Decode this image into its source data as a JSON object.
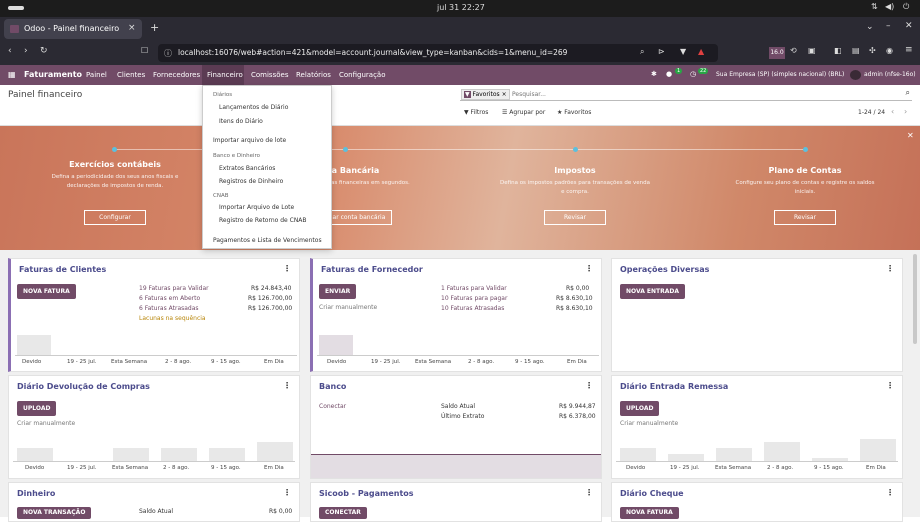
{
  "os": {
    "clock": "jul 31  22:27"
  },
  "browser": {
    "tab_title": "Odoo - Painel financeiro",
    "new_tab": "+",
    "url": "localhost:16076/web#action=421&model=account.journal&view_type=kanban&cids=1&menu_id=269",
    "version_badge": "16.0"
  },
  "nav": {
    "app": "Faturamento",
    "items": [
      "Painel",
      "Clientes",
      "Fornecedores",
      "Financeiro",
      "Comissões",
      "Relatórios",
      "Configuração"
    ],
    "msg_count": "1",
    "activity_count": "22",
    "company": "Sua Empresa (SP) (simples nacional) (BRL)",
    "user": "admin (nfse-16o)"
  },
  "control": {
    "title": "Painel financeiro",
    "facet": "Favoritos",
    "search_placeholder": "Pesquisar...",
    "filters": "Filtros",
    "group": "Agrupar por",
    "favorites": "Favoritos",
    "pager": "1-24 / 24"
  },
  "menu": {
    "s1": "Diários",
    "i1": "Lançamentos de Diário",
    "i2": "Itens do Diário",
    "i3": "Importar arquivo de lote",
    "s2": "Banco e Dinheiro",
    "i4": "Extratos Bancários",
    "i5": "Registros de Dinheiro",
    "s3": "CNAB",
    "i6": "Importar Arquivo de Lote",
    "i7": "Registro de Retorno de CNAB",
    "i8": "Pagamentos e Lista de Vencimentos"
  },
  "onboarding": {
    "s1": {
      "title": "Exercícios contábeis",
      "desc": "Defina a periodicidade dos seus anos fiscais e declarações de impostos de renda.",
      "btn": "Configurar"
    },
    "s2": {
      "title": "Conta Bancária",
      "desc": "Conecte suas contas financeiras em segundos.",
      "btn": "Adicionar conta bancária"
    },
    "s3": {
      "title": "Impostos",
      "desc": "Defina os impostos padrões para transações de venda e compra.",
      "btn": "Revisar"
    },
    "s4": {
      "title": "Plano de Contas",
      "desc": "Configure seu plano de contas e registre os saldos iniciais.",
      "btn": "Revisar"
    }
  },
  "cards": {
    "c1": {
      "title": "Faturas de Clientes",
      "btn": "NOVA FATURA",
      "l1": "19 Faturas para Validar",
      "v1": "R$ 24.843,40",
      "l2": "6 Faturas em Aberto",
      "v2": "R$ 126.700,00",
      "l3": "6 Faturas Atrasadas",
      "v3": "R$ 126.700,00",
      "l4": "Lacunas na sequência"
    },
    "c2": {
      "title": "Faturas de Fornecedor",
      "btn": "ENVIAR",
      "manual": "Criar manualmente",
      "l1": "1 Faturas para Validar",
      "v1": "R$ 0,00",
      "l2": "10 Faturas para pagar",
      "v2": "R$ 8.630,10",
      "l3": "10 Faturas Atrasadas",
      "v3": "R$ 8.630,10"
    },
    "c3": {
      "title": "Operações Diversas",
      "btn": "NOVA ENTRADA"
    },
    "c4": {
      "title": "Diário Devolução de Compras",
      "btn": "UPLOAD",
      "manual": "Criar manualmente"
    },
    "c5": {
      "title": "Banco",
      "connect": "Conectar",
      "l1": "Saldo Atual",
      "v1": "R$ 9.944,87",
      "l2": "Último Extrato",
      "v2": "R$ 6.378,00"
    },
    "c6": {
      "title": "Diário Entrada Remessa",
      "btn": "UPLOAD",
      "manual": "Criar manualmente"
    },
    "c7": {
      "title": "Dinheiro",
      "btn": "NOVA TRANSAÇÃO",
      "l1": "Saldo Atual",
      "v1": "R$ 0,00"
    },
    "c8": {
      "title": "Sicoob - Pagamentos",
      "btn": "CONECTAR"
    },
    "c9": {
      "title": "Diário Cheque",
      "btn": "NOVA FATURA"
    }
  },
  "axis": [
    "Devido",
    "19 - 25 jul.",
    "Esta Semana",
    "2 - 8 ago.",
    "9 - 15 ago.",
    "Em Dia"
  ]
}
